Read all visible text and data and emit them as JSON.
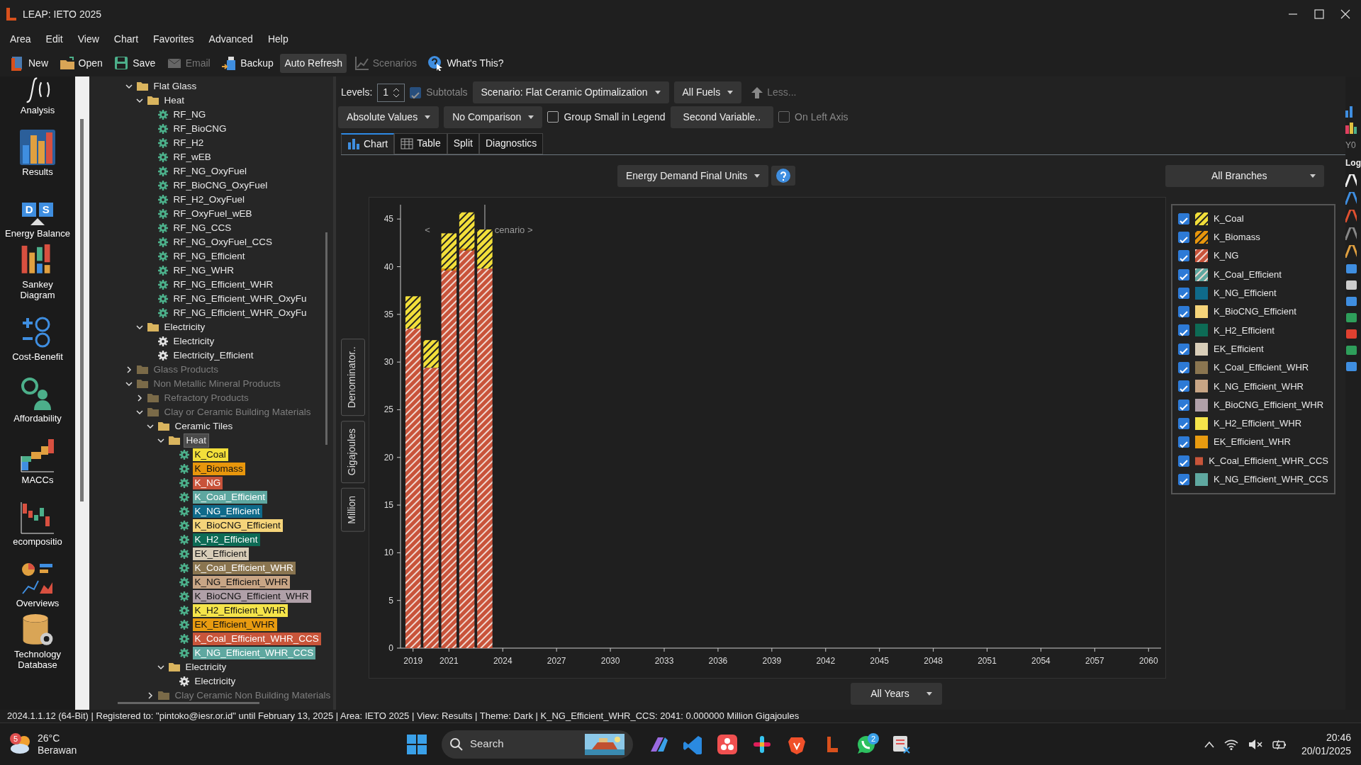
{
  "window": {
    "title": "LEAP: IETO 2025"
  },
  "menu": [
    "Area",
    "Edit",
    "View",
    "Chart",
    "Favorites",
    "Advanced",
    "Help"
  ],
  "toolbar": [
    {
      "label": "New",
      "kind": "new",
      "disabled": false,
      "pressed": false
    },
    {
      "label": "Open",
      "kind": "open",
      "disabled": false,
      "pressed": false
    },
    {
      "label": "Save",
      "kind": "save",
      "disabled": false,
      "pressed": false
    },
    {
      "label": "Email",
      "kind": "email",
      "disabled": true,
      "pressed": false
    },
    {
      "label": "Backup",
      "kind": "backup",
      "disabled": false,
      "pressed": false
    },
    {
      "label": "Auto Refresh",
      "kind": "none",
      "disabled": false,
      "pressed": true
    },
    {
      "label": "Scenarios",
      "kind": "scenarios",
      "disabled": true,
      "pressed": false
    },
    {
      "label": "What's This?",
      "kind": "help",
      "disabled": false,
      "pressed": false
    }
  ],
  "sidebar": {
    "items": [
      {
        "label": "Analysis",
        "kind": "analysis",
        "selected": false
      },
      {
        "label": "Results",
        "kind": "results",
        "selected": true
      },
      {
        "label": "Energy Balance",
        "kind": "balance",
        "selected": false,
        "badges": [
          "D",
          "S"
        ]
      },
      {
        "label": "Sankey Diagram",
        "kind": "sankey",
        "selected": false
      },
      {
        "label": "Cost-Benefit",
        "kind": "cost",
        "selected": false
      },
      {
        "label": "Affordability",
        "kind": "afford",
        "selected": false
      },
      {
        "label": "MACCs",
        "kind": "macc",
        "selected": false
      },
      {
        "label": "ecompositio",
        "kind": "decomp",
        "selected": false
      },
      {
        "label": "Overviews",
        "kind": "overview",
        "selected": false
      },
      {
        "label": "Technology Database",
        "kind": "database",
        "selected": false
      }
    ]
  },
  "tree": {
    "items": [
      {
        "label": "Flat Glass",
        "kind": "folder",
        "expanded": true,
        "dimmed": false,
        "selected": false,
        "children": [
          {
            "label": "Heat",
            "kind": "folder",
            "expanded": true,
            "dimmed": false,
            "selected": false,
            "children": [
              {
                "label": "RF_NG",
                "kind": "process",
                "dimmed": false,
                "selected": false
              },
              {
                "label": "RF_BioCNG",
                "kind": "process",
                "dimmed": false,
                "selected": false
              },
              {
                "label": "RF_H2",
                "kind": "process",
                "dimmed": false,
                "selected": false
              },
              {
                "label": "RF_wEB",
                "kind": "process",
                "dimmed": false,
                "selected": false
              },
              {
                "label": "RF_NG_OxyFuel",
                "kind": "process",
                "dimmed": false,
                "selected": false
              },
              {
                "label": "RF_BioCNG_OxyFuel",
                "kind": "process",
                "dimmed": false,
                "selected": false
              },
              {
                "label": "RF_H2_OxyFuel",
                "kind": "process",
                "dimmed": false,
                "selected": false
              },
              {
                "label": "RF_OxyFuel_wEB",
                "kind": "process",
                "dimmed": false,
                "selected": false
              },
              {
                "label": "RF_NG_CCS",
                "kind": "process",
                "dimmed": false,
                "selected": false
              },
              {
                "label": "RF_NG_OxyFuel_CCS",
                "kind": "process",
                "dimmed": false,
                "selected": false
              },
              {
                "label": "RF_NG_Efficient",
                "kind": "process",
                "dimmed": false,
                "selected": false
              },
              {
                "label": "RF_NG_WHR",
                "kind": "process",
                "dimmed": false,
                "selected": false
              },
              {
                "label": "RF_NG_Efficient_WHR",
                "kind": "process",
                "dimmed": false,
                "selected": false
              },
              {
                "label": "RF_NG_Efficient_WHR_OxyFu",
                "kind": "process",
                "dimmed": false,
                "selected": false
              },
              {
                "label": "RF_NG_Efficient_WHR_OxyFu",
                "kind": "process",
                "dimmed": false,
                "selected": false
              }
            ]
          },
          {
            "label": "Electricity",
            "kind": "folder",
            "expanded": true,
            "dimmed": false,
            "selected": false,
            "children": [
              {
                "label": "Electricity",
                "kind": "device",
                "dimmed": false,
                "selected": false
              },
              {
                "label": "Electricity_Efficient",
                "kind": "device",
                "dimmed": false,
                "selected": false
              }
            ]
          }
        ]
      },
      {
        "label": "Glass Products",
        "kind": "folder",
        "expanded": false,
        "dimmed": true,
        "selected": false
      },
      {
        "label": "Non Metallic Mineral Products",
        "kind": "folder",
        "expanded": true,
        "dimmed": true,
        "selected": false,
        "children": [
          {
            "label": "Refractory Products",
            "kind": "folder",
            "expanded": false,
            "dimmed": true,
            "selected": false
          },
          {
            "label": "Clay or Ceramic Building Materials",
            "kind": "folder",
            "expanded": true,
            "dimmed": true,
            "selected": false,
            "children": [
              {
                "label": "Ceramic Tiles",
                "kind": "folder",
                "expanded": true,
                "dimmed": false,
                "selected": false,
                "children": [
                  {
                    "label": "Heat",
                    "kind": "folder",
                    "expanded": true,
                    "dimmed": false,
                    "selected": true,
                    "children": [
                      {
                        "label": "K_Coal",
                        "kind": "process",
                        "dimmed": false,
                        "selected": false,
                        "color": "#f2df3a"
                      },
                      {
                        "label": "K_Biomass",
                        "kind": "process",
                        "dimmed": false,
                        "selected": false,
                        "color": "#e8960c"
                      },
                      {
                        "label": "K_NG",
                        "kind": "process",
                        "dimmed": false,
                        "selected": false,
                        "color": "#c8533a"
                      },
                      {
                        "label": "K_Coal_Efficient",
                        "kind": "process",
                        "dimmed": false,
                        "selected": false,
                        "color": "#5ea7a0"
                      },
                      {
                        "label": "K_NG_Efficient",
                        "kind": "process",
                        "dimmed": false,
                        "selected": false,
                        "color": "#0f6a8a"
                      },
                      {
                        "label": "K_BioCNG_Efficient",
                        "kind": "process",
                        "dimmed": false,
                        "selected": false,
                        "color": "#f5d47a"
                      },
                      {
                        "label": "K_H2_Efficient",
                        "kind": "process",
                        "dimmed": false,
                        "selected": false,
                        "color": "#0d6b55"
                      },
                      {
                        "label": "EK_Efficient",
                        "kind": "process",
                        "dimmed": false,
                        "selected": false,
                        "color": "#d8cdb8"
                      },
                      {
                        "label": "K_Coal_Efficient_WHR",
                        "kind": "process",
                        "dimmed": false,
                        "selected": false,
                        "color": "#8a7550"
                      },
                      {
                        "label": "K_NG_Efficient_WHR",
                        "kind": "process",
                        "dimmed": false,
                        "selected": false,
                        "color": "#c8a585"
                      },
                      {
                        "label": "K_BioCNG_Efficient_WHR",
                        "kind": "process",
                        "dimmed": false,
                        "selected": false,
                        "color": "#b0a0a8"
                      },
                      {
                        "label": "K_H2_Efficient_WHR",
                        "kind": "process",
                        "dimmed": false,
                        "selected": false,
                        "color": "#f5e44a"
                      },
                      {
                        "label": "EK_Efficient_WHR",
                        "kind": "process",
                        "dimmed": false,
                        "selected": false,
                        "color": "#e89b10"
                      },
                      {
                        "label": "K_Coal_Efficient_WHR_CCS",
                        "kind": "process",
                        "dimmed": false,
                        "selected": false,
                        "color": "#c8553a"
                      },
                      {
                        "label": "K_NG_Efficient_WHR_CCS",
                        "kind": "process",
                        "dimmed": false,
                        "selected": false,
                        "color": "#5fa8a0"
                      }
                    ]
                  },
                  {
                    "label": "Electricity",
                    "kind": "folder",
                    "expanded": true,
                    "dimmed": false,
                    "selected": false,
                    "children": [
                      {
                        "label": "Electricity",
                        "kind": "device",
                        "dimmed": false,
                        "selected": false
                      }
                    ]
                  }
                ]
              },
              {
                "label": "Clay Ceramic Non Building Materials",
                "kind": "folder",
                "expanded": false,
                "dimmed": true,
                "selected": false
              }
            ]
          }
        ]
      }
    ]
  },
  "controls": {
    "levels_label": "Levels:",
    "levels_value": "1",
    "subtotals": {
      "label": "Subtotals",
      "checked": true,
      "disabled": true
    },
    "scenario": "Scenario: Flat Ceramic Optimalization",
    "fuels": "All Fuels",
    "less": "Less...",
    "values": "Absolute Values",
    "comparison": "No Comparison",
    "group_small": {
      "label": "Group Small in Legend",
      "checked": false,
      "disabled": false
    },
    "second_variable": "Second Variable..",
    "on_left_axis": {
      "label": "On Left Axis",
      "checked": false,
      "disabled": true
    }
  },
  "tabs": [
    {
      "label": "Chart",
      "kind": "chart",
      "selected": true
    },
    {
      "label": "Table",
      "kind": "table",
      "selected": false
    },
    {
      "label": "Split",
      "kind": "none",
      "selected": false
    },
    {
      "label": "Diagnostics",
      "kind": "none",
      "selected": false
    }
  ],
  "variable": "Energy Demand Final Units",
  "branches": "All Branches",
  "side_tabs": [
    "Denominator..",
    "Gigajoules",
    "Million"
  ],
  "chart_data": {
    "type": "bar",
    "stacked": true,
    "x": [
      2019,
      2020,
      2021,
      2022,
      2023
    ],
    "xlim": [
      2018.3,
      2060.7
    ],
    "ylim": [
      0,
      46.5
    ],
    "xticks": [
      2019,
      2021,
      2024,
      2027,
      2030,
      2033,
      2036,
      2039,
      2042,
      2045,
      2048,
      2051,
      2054,
      2057,
      2060
    ],
    "yticks": [
      0,
      5,
      10,
      15,
      20,
      25,
      30,
      35,
      40,
      45
    ],
    "series": [
      {
        "name": "K_Coal",
        "color": "#f2df3a",
        "values": [
          3.4,
          2.9,
          3.7,
          3.8,
          4.1
        ]
      },
      {
        "name": "K_Biomass",
        "color": "#e8960c",
        "values": [
          0,
          0,
          0.2,
          0.2,
          0
        ]
      },
      {
        "name": "K_NG",
        "color": "#c8533a",
        "values": [
          33.5,
          29.4,
          39.6,
          41.7,
          39.8
        ]
      }
    ],
    "ref_lines": [
      {
        "axis": "x",
        "value": 2023
      }
    ],
    "legend": "right",
    "annotations": [
      "<",
      "cenario >"
    ]
  },
  "series_legend": [
    {
      "checked": true,
      "hatched": true
    },
    {
      "checked": true,
      "hatched": true
    },
    {
      "checked": true,
      "hatched": true
    }
  ],
  "legend": [
    {
      "label": "K_Coal_Efficient",
      "checked": true,
      "color": "#5ea7a0",
      "hatched": true
    },
    {
      "label": "K_NG_Efficient",
      "checked": true,
      "color": "#0f6a8a",
      "hatched": false
    },
    {
      "label": "K_BioCNG_Efficient",
      "checked": true,
      "color": "#f5d47a",
      "hatched": false
    },
    {
      "label": "K_H2_Efficient",
      "checked": true,
      "color": "#0d6b55",
      "hatched": false
    },
    {
      "label": "EK_Efficient",
      "checked": true,
      "color": "#d8cdb8",
      "hatched": false
    },
    {
      "label": "K_Coal_Efficient_WHR",
      "checked": true,
      "color": "#8a7550",
      "hatched": false
    },
    {
      "label": "K_NG_Efficient_WHR",
      "checked": true,
      "color": "#c8a585",
      "hatched": false
    },
    {
      "label": "K_BioCNG_Efficient_WHR",
      "checked": true,
      "color": "#b0a0a8",
      "hatched": false
    },
    {
      "label": "K_H2_Efficient_WHR",
      "checked": true,
      "color": "#f5e44a",
      "hatched": false
    },
    {
      "label": "EK_Efficient_WHR",
      "checked": true,
      "color": "#e89b10",
      "hatched": false
    },
    {
      "label": "K_Coal_Efficient_WHR_CCS",
      "checked": true,
      "color": "#c8553a",
      "hatched": false
    },
    {
      "label": "K_NG_Efficient_WHR_CCS",
      "checked": true,
      "color": "#5fa8a0",
      "hatched": false
    }
  ],
  "right_toolbar": {
    "texts": [
      "Y0",
      "Log"
    ]
  },
  "years": "All Years",
  "status_bar": "2024.1.1.12 (64-Bit)  |  Registered to: \"pintoko@iesr.or.id\" until February 13, 2025  |  Area: IETO 2025  |  View: Results  |  Theme: Dark  |  K_NG_Efficient_WHR_CCS: 2041: 0.000000 Million Gigajoules",
  "taskbar": {
    "weather_badge": "5",
    "temperature": "26°C",
    "weather": "Berawan",
    "search": "Search",
    "whatsapp_badge": "2",
    "time": "20:46",
    "date": "20/01/2025"
  }
}
